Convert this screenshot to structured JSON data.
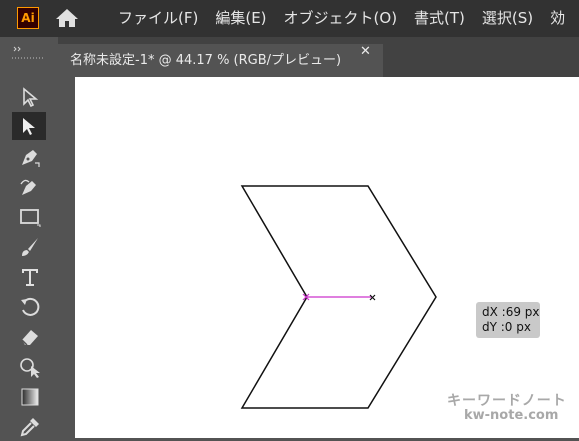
{
  "app": {
    "logo_text": "Ai",
    "logo_color": "#ff9a00"
  },
  "menu": {
    "items": [
      "ファイル(F)",
      "編集(E)",
      "オブジェクト(O)",
      "書式(T)",
      "選択(S)",
      "効"
    ]
  },
  "document_tab": {
    "title": "名称未設定-1* @ 44.17 % (RGB/プレビュー)",
    "close_glyph": "✕"
  },
  "tools": [
    "selection-tool",
    "direct-selection-tool",
    "pen-tool",
    "curvature-tool",
    "rectangle-tool",
    "paintbrush-tool",
    "type-tool",
    "rotate-tool",
    "eraser-tool",
    "shape-builder-tool",
    "gradient-tool",
    "eyedropper-tool"
  ],
  "tooltip": {
    "dx": "dX :69 px",
    "dy": "dY :0 px"
  },
  "watermark": {
    "japanese": "キーワードノート",
    "url": "kw-note.com"
  },
  "colors": {
    "guide": "#cc33cc",
    "accent": "#ff9a00"
  }
}
